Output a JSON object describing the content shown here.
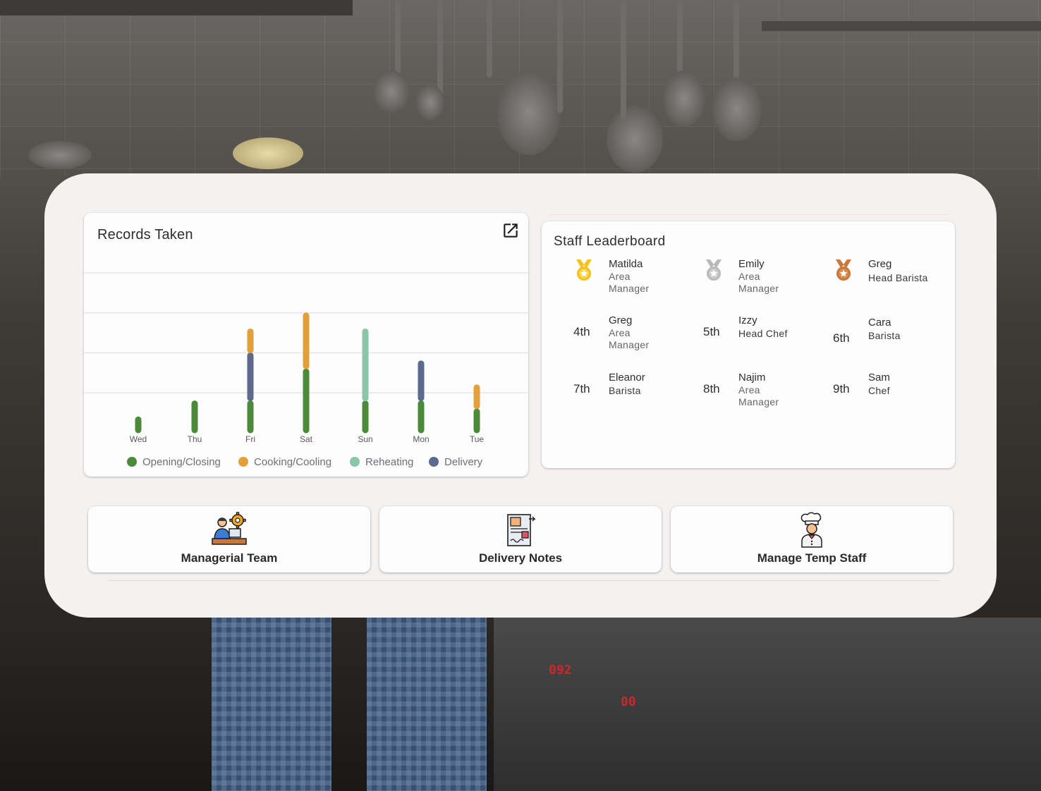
{
  "records": {
    "title": "Records Taken",
    "open_icon": "open-in-new-icon"
  },
  "chart_data": {
    "type": "bar",
    "stacked": true,
    "categories": [
      "Wed",
      "Thu",
      "Fri",
      "Sat",
      "Sun",
      "Mon",
      "Tue"
    ],
    "series": [
      {
        "name": "Opening/Closing",
        "color": "#4b8a3a",
        "values": [
          1,
          2,
          2,
          4,
          2,
          2,
          1.5
        ]
      },
      {
        "name": "Cooking/Cooling",
        "color": "#e3a03a",
        "values": [
          0,
          0,
          1.5,
          3.5,
          0,
          0,
          1.5
        ]
      },
      {
        "name": "Reheating",
        "color": "#8cc6a8",
        "values": [
          0,
          0,
          0,
          0,
          4.5,
          0,
          0
        ]
      },
      {
        "name": "Delivery",
        "color": "#5d6a8e",
        "values": [
          0,
          0,
          3,
          0,
          0,
          2.5,
          0
        ]
      }
    ],
    "ylim": [
      0,
      10
    ],
    "grid": true,
    "legend_position": "bottom"
  },
  "leaderboard": {
    "title": "Staff Leaderboard",
    "entries": [
      {
        "rank": "",
        "medal": "gold-medal-icon",
        "name": "Matilda",
        "role": "Area Manager"
      },
      {
        "rank": "",
        "medal": "silver-medal-icon",
        "name": "Emily",
        "role": "Area Manager"
      },
      {
        "rank": "",
        "medal": "bronze-medal-icon",
        "name": "Greg",
        "role": "Head Barista"
      },
      {
        "rank": "4th",
        "medal": "",
        "name": "Greg",
        "role": "Area Manager"
      },
      {
        "rank": "5th",
        "medal": "",
        "name": "Izzy",
        "role": "Head Chef"
      },
      {
        "rank": "6th",
        "medal": "",
        "name": "Cara",
        "role": "Barista"
      },
      {
        "rank": "7th",
        "medal": "",
        "name": "Eleanor",
        "role": "Barista"
      },
      {
        "rank": "8th",
        "medal": "",
        "name": "Najim",
        "role": "Area Manager"
      },
      {
        "rank": "9th",
        "medal": "",
        "name": "Sam",
        "role": "Chef"
      }
    ]
  },
  "actions": [
    {
      "label": "Managerial Team",
      "icon": "manager-at-desk-icon"
    },
    {
      "label": "Delivery Notes",
      "icon": "delivery-note-icon"
    },
    {
      "label": "Manage Temp Staff",
      "icon": "chef-icon"
    }
  ],
  "colors": {
    "panel": "#f4f2f1",
    "card": "#fcfcfc",
    "gold": "#f2c21b",
    "silver": "#b9b9b9",
    "bronze": "#c8783a"
  }
}
